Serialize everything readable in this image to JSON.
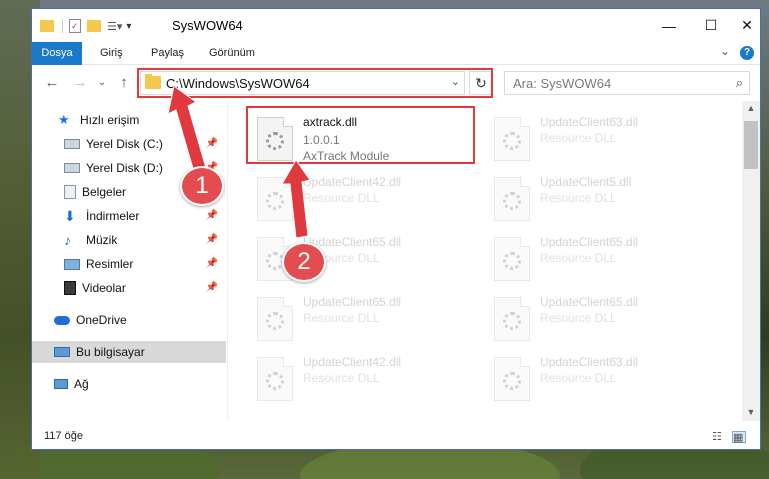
{
  "window": {
    "title": "SysWOW64",
    "minimize_glyph": "—",
    "maximize_glyph": "☐",
    "close_glyph": "✕"
  },
  "ribbon": {
    "tabs": [
      "Dosya",
      "Giriş",
      "Paylaş",
      "Görünüm"
    ],
    "expand_glyph": "⌄",
    "help_glyph": "?"
  },
  "nav": {
    "back_glyph": "←",
    "forward_glyph": "→",
    "recent_glyph": "⌄",
    "up_glyph": "↑"
  },
  "address": {
    "path": "C:\\Windows\\SysWOW64",
    "dropdown_glyph": "⌄",
    "refresh_glyph": "↻"
  },
  "search": {
    "placeholder": "Ara: SysWOW64",
    "icon": "search-icon"
  },
  "sidebar": {
    "items": [
      {
        "label": "Hızlı erişim",
        "icon": "star-icon"
      },
      {
        "label": "Yerel Disk (C:)",
        "icon": "drive-icon",
        "pinned": true
      },
      {
        "label": "Yerel Disk (D:)",
        "icon": "drive-icon",
        "pinned": true
      },
      {
        "label": "Belgeler",
        "icon": "documents-icon",
        "pinned": true
      },
      {
        "label": "İndirmeler",
        "icon": "download-icon",
        "pinned": true
      },
      {
        "label": "Müzik",
        "icon": "music-icon",
        "pinned": true
      },
      {
        "label": "Resimler",
        "icon": "pictures-icon",
        "pinned": true
      },
      {
        "label": "Videolar",
        "icon": "videos-icon",
        "pinned": true
      },
      {
        "label": "OneDrive",
        "icon": "cloud-icon"
      },
      {
        "label": "Bu bilgisayar",
        "icon": "computer-icon",
        "selected": true
      },
      {
        "label": "Ağ",
        "icon": "network-icon"
      }
    ]
  },
  "files": {
    "highlighted": {
      "name": "axtrack.dll",
      "version": "1.0.0.1",
      "description": "AxTrack Module"
    },
    "items": [
      {
        "name": "UpdateClient63.dll",
        "type": "Resource DLL"
      },
      {
        "name": "UpdateClient42.dll",
        "type": "Resource DLL"
      },
      {
        "name": "UpdateClient5.dll",
        "type": "Resource DLL"
      },
      {
        "name": "UpdateClient65.dll",
        "type": "Resource DLL"
      },
      {
        "name": "UpdateClient65.dll",
        "type": "Resource DLL"
      },
      {
        "name": "UpdateClient65.dll",
        "type": "Resource DLL"
      },
      {
        "name": "UpdateClient65.dll",
        "type": "Resource DLL"
      },
      {
        "name": "UpdateClient42.dll",
        "type": "Resource DLL"
      },
      {
        "name": "UpdateClient63.dll",
        "type": "Resource DLL"
      }
    ]
  },
  "status": {
    "count": "117 öğe"
  },
  "annotations": {
    "step1": "1",
    "step2": "2",
    "color": "#e0393e"
  }
}
